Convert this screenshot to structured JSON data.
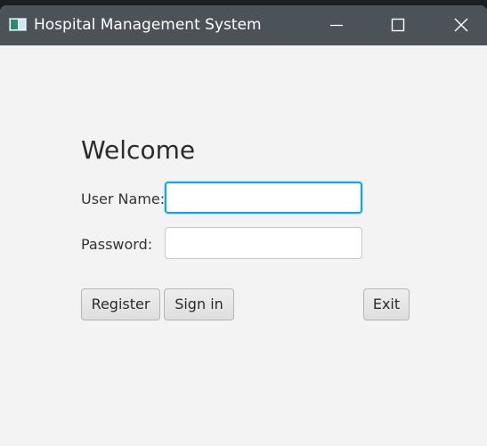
{
  "window": {
    "title": "Hospital Management System",
    "icon": "app-window-icon",
    "controls": {
      "minimize": "minimize-icon",
      "maximize": "maximize-icon",
      "close": "close-icon"
    }
  },
  "login": {
    "heading": "Welcome",
    "username_label": "User Name:",
    "username_value": "",
    "password_label": "Password:",
    "password_value": "",
    "register_label": "Register",
    "signin_label": "Sign in",
    "exit_label": "Exit"
  },
  "colors": {
    "titlebar": "#4b5258",
    "background": "#f3f3f3",
    "focus_ring": "#1aa3dd"
  }
}
